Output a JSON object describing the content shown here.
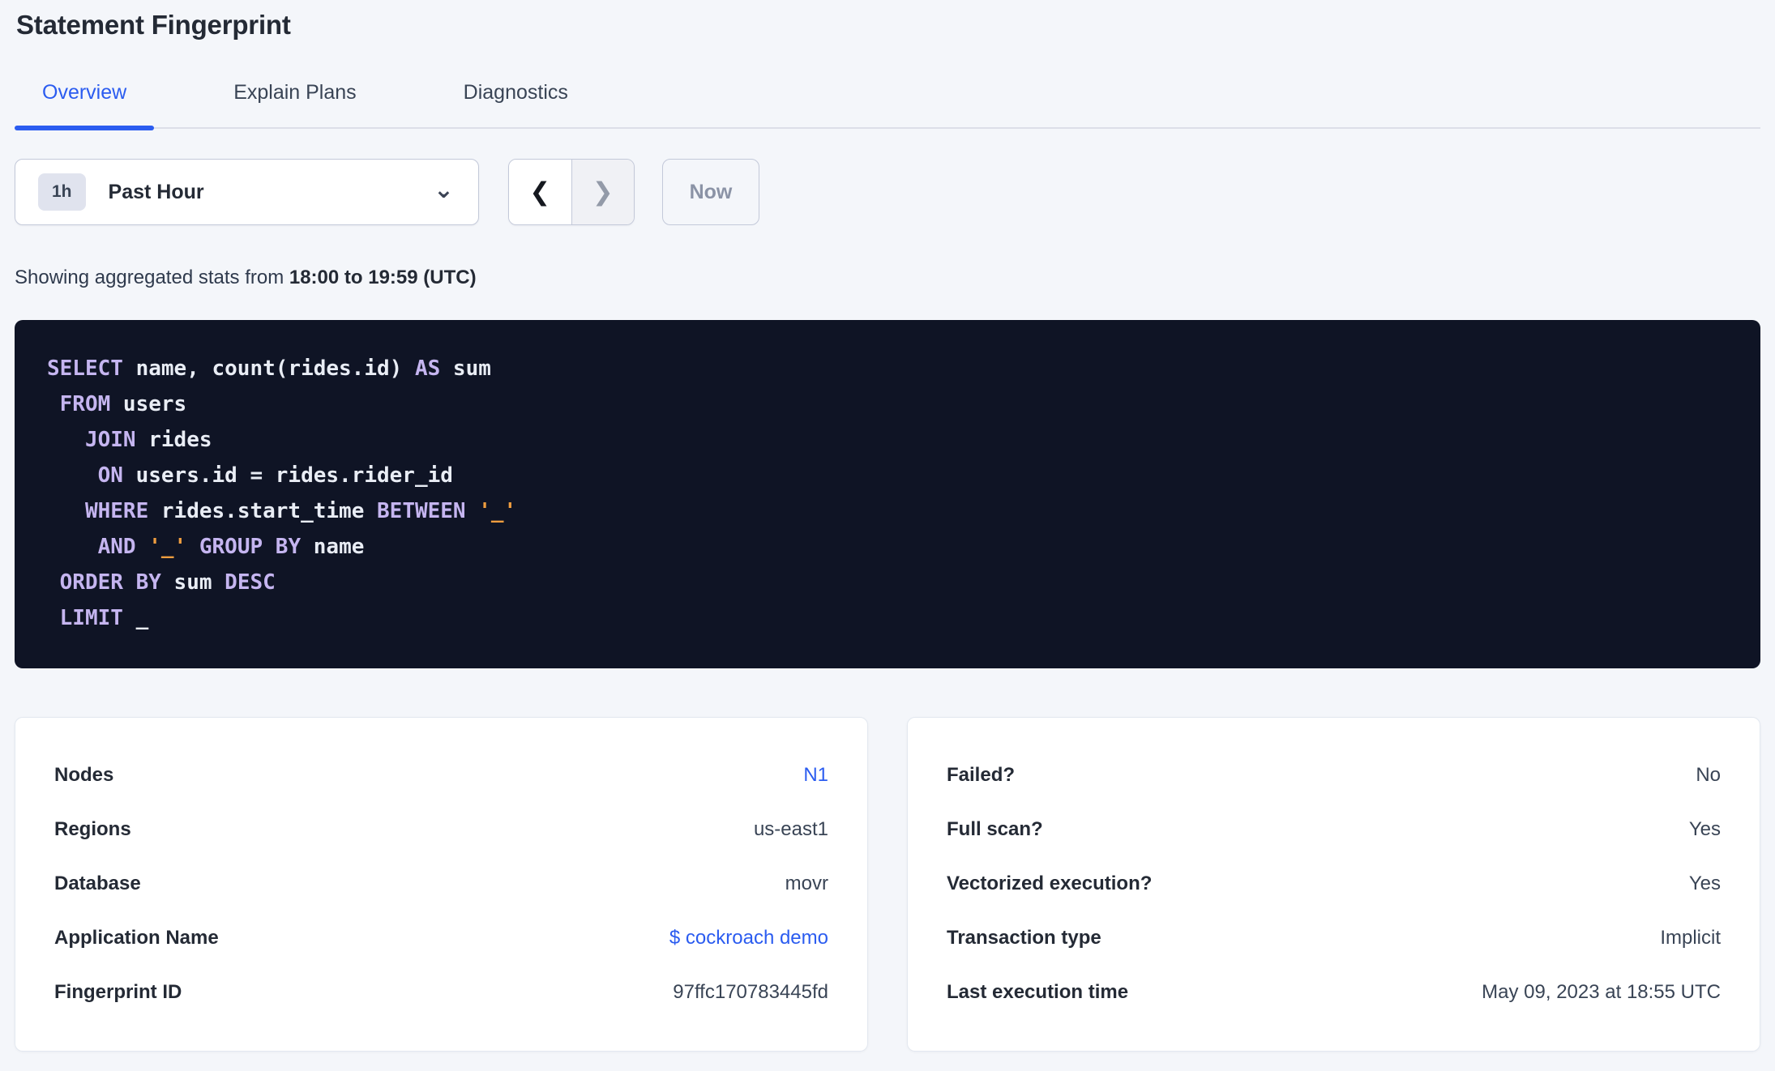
{
  "page": {
    "title": "Statement Fingerprint",
    "background_color": "#f4f6fa",
    "accent_color": "#2b5cf0"
  },
  "tabs": [
    {
      "label": "Overview",
      "active": true
    },
    {
      "label": "Explain Plans",
      "active": false
    },
    {
      "label": "Diagnostics",
      "active": false
    }
  ],
  "time_controls": {
    "interval_badge": "1h",
    "interval_label": "Past Hour",
    "now_label": "Now",
    "icons": {
      "chevron_down": "⌄",
      "chevron_left": "❮",
      "chevron_right": "❯"
    }
  },
  "stats_line": {
    "prefix": "Showing aggregated stats from ",
    "range_bold": "18:00 to 19:59 (UTC)"
  },
  "sql": {
    "background_color": "#0f1425",
    "colors": {
      "keyword": "#c5b5f0",
      "identifier": "#e9edf5",
      "string": "#ee9d3f"
    },
    "lines": [
      [
        [
          "k",
          "SELECT"
        ],
        [
          "i",
          " name, count(rides.id) "
        ],
        [
          "k",
          "AS"
        ],
        [
          "i",
          " sum"
        ]
      ],
      [
        [
          "i",
          " "
        ],
        [
          "k",
          "FROM"
        ],
        [
          "i",
          " users"
        ]
      ],
      [
        [
          "i",
          "   "
        ],
        [
          "k",
          "JOIN"
        ],
        [
          "i",
          " rides"
        ]
      ],
      [
        [
          "i",
          "    "
        ],
        [
          "k",
          "ON"
        ],
        [
          "i",
          " users.id = rides.rider_id"
        ]
      ],
      [
        [
          "i",
          "   "
        ],
        [
          "k",
          "WHERE"
        ],
        [
          "i",
          " rides.start_time "
        ],
        [
          "k",
          "BETWEEN"
        ],
        [
          "i",
          " "
        ],
        [
          "s",
          "'_'"
        ]
      ],
      [
        [
          "i",
          "    "
        ],
        [
          "k",
          "AND"
        ],
        [
          "i",
          " "
        ],
        [
          "s",
          "'_'"
        ],
        [
          "i",
          " "
        ],
        [
          "k",
          "GROUP BY"
        ],
        [
          "i",
          " name"
        ]
      ],
      [
        [
          "i",
          " "
        ],
        [
          "k",
          "ORDER BY"
        ],
        [
          "i",
          " sum "
        ],
        [
          "k",
          "DESC"
        ]
      ],
      [
        [
          "i",
          " "
        ],
        [
          "k",
          "LIMIT"
        ],
        [
          "i",
          " _"
        ]
      ]
    ]
  },
  "left_card": {
    "rows": [
      {
        "label": "Nodes",
        "value": "N1",
        "is_link": true
      },
      {
        "label": "Regions",
        "value": "us-east1",
        "is_link": false
      },
      {
        "label": "Database",
        "value": "movr",
        "is_link": false
      },
      {
        "label": "Application Name",
        "value": "$ cockroach demo",
        "is_link": true
      },
      {
        "label": "Fingerprint ID",
        "value": "97ffc170783445fd",
        "is_link": false
      }
    ]
  },
  "right_card": {
    "rows": [
      {
        "label": "Failed?",
        "value": "No"
      },
      {
        "label": "Full scan?",
        "value": "Yes"
      },
      {
        "label": "Vectorized execution?",
        "value": "Yes"
      },
      {
        "label": "Transaction type",
        "value": "Implicit"
      },
      {
        "label": "Last execution time",
        "value": "May 09, 2023 at 18:55 UTC"
      }
    ]
  }
}
